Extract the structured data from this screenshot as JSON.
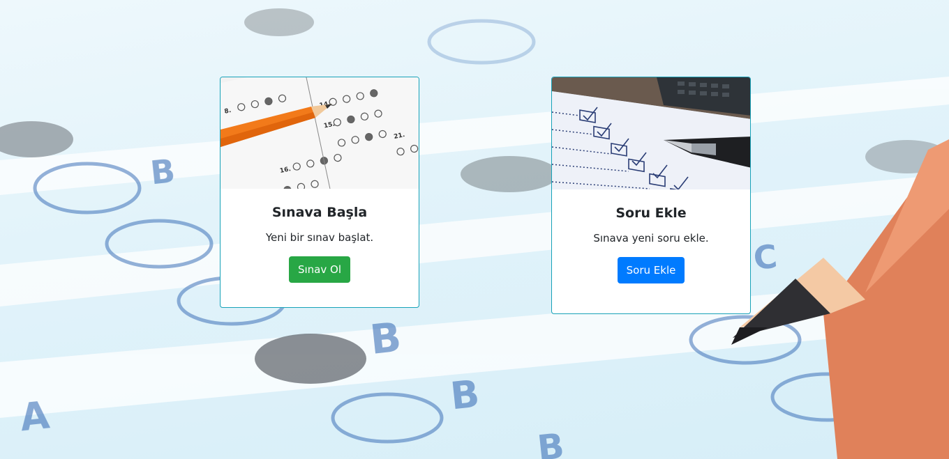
{
  "cards": [
    {
      "title": "Sınava Başla",
      "text": "Yeni bir sınav başlat.",
      "button_label": "Sınav Ol",
      "button_color": "#28a745",
      "image": "answer-sheet-with-orange-pencil"
    },
    {
      "title": "Soru Ekle",
      "text": "Sınava yeni soru ekle.",
      "button_label": "Soru Ekle",
      "button_color": "#007bff",
      "image": "checklist-with-pen-and-calculator"
    }
  ],
  "colors": {
    "card_border": "#17a2b8",
    "success": "#28a745",
    "primary": "#007bff"
  },
  "background": "optical-answer-sheet-with-pencil"
}
